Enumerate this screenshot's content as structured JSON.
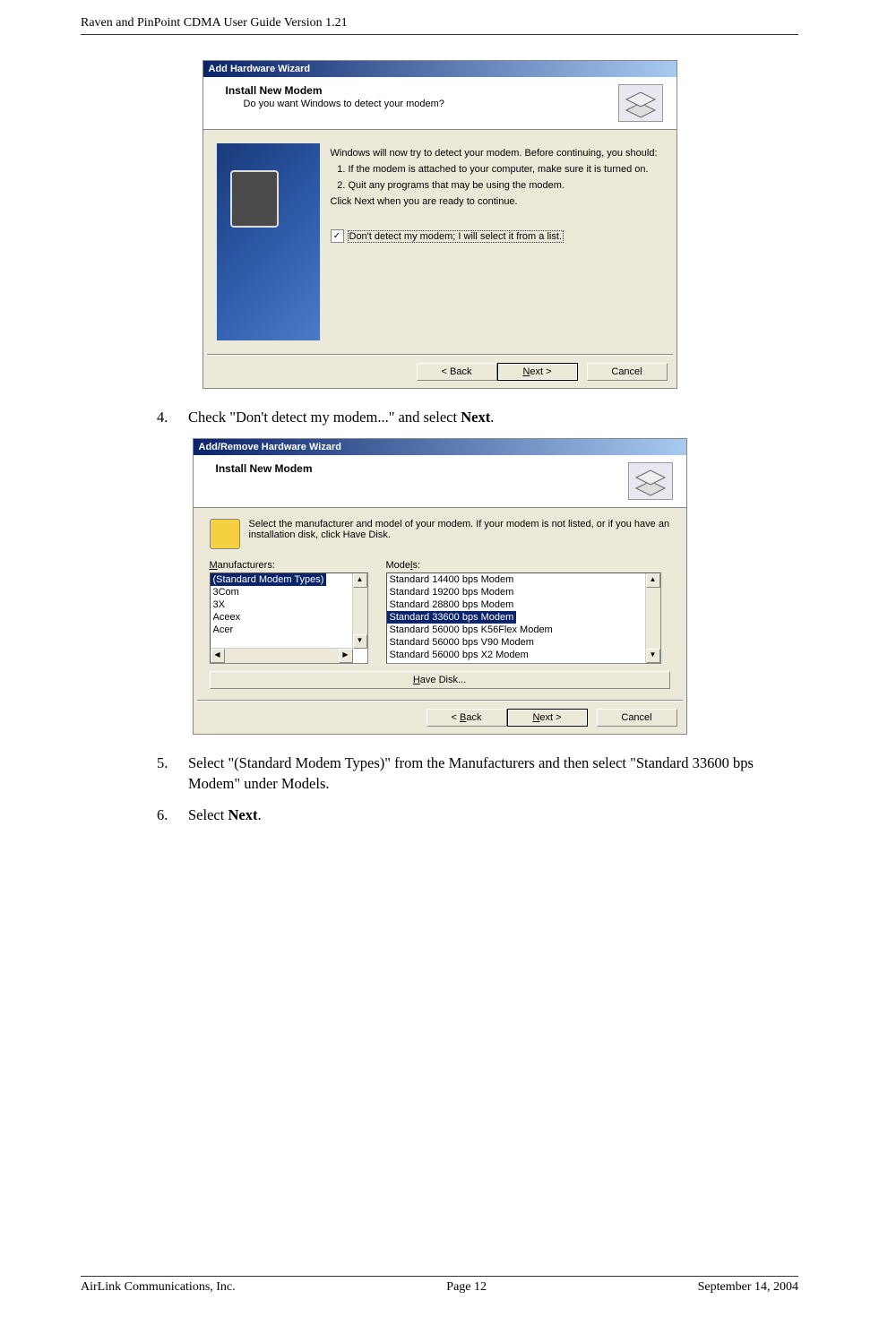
{
  "header": "Raven and PinPoint CDMA User Guide Version 1.21",
  "wizard1": {
    "title": "Add Hardware Wizard",
    "heading": "Install New Modem",
    "subheading": "Do you want Windows to detect your modem?",
    "bodyTop": "Windows will now try to detect your modem.  Before continuing, you should:",
    "list1": "If the modem is attached to your computer, make sure it is turned on.",
    "list2": "Quit any programs that may be using the modem.",
    "bodyBottom": "Click Next when you are ready to continue.",
    "checkboxLabel": "Don't detect my modem; I will select it from a list.",
    "buttons": {
      "back": "< Back",
      "next": "Next >",
      "cancel": "Cancel"
    }
  },
  "step4": {
    "num": "4.",
    "text_a": "Check \"Don't detect my modem...\" and select ",
    "text_b": "Next",
    "text_c": "."
  },
  "wizard2": {
    "title": "Add/Remove Hardware Wizard",
    "heading": "Install New Modem",
    "desc": "Select the manufacturer and model of your modem. If your modem is not listed, or if you have an installation disk, click Have Disk.",
    "mfrLabel": "Manufacturers:",
    "modelsLabel": "Models:",
    "manufacturers": [
      "(Standard Modem Types)",
      "3Com",
      "3X",
      "Aceex",
      "Acer"
    ],
    "models": [
      "Standard 14400 bps Modem",
      "Standard 19200 bps Modem",
      "Standard 28800 bps Modem",
      "Standard 33600 bps Modem",
      "Standard 56000 bps K56Flex Modem",
      "Standard 56000 bps V90 Modem",
      "Standard 56000 bps X2 Modem"
    ],
    "haveDisk": "Have Disk...",
    "buttons": {
      "back": "< Back",
      "next": "Next >",
      "cancel": "Cancel"
    }
  },
  "step5": {
    "num": "5.",
    "text": "Select \"(Standard Modem Types)\" from the Manufacturers and then select \"Standard 33600 bps Modem\" under Models."
  },
  "step6": {
    "num": "6.",
    "text_a": "Select ",
    "text_b": "Next",
    "text_c": "."
  },
  "footer": {
    "left": "AirLink Communications, Inc.",
    "center": "Page 12",
    "right": "September 14, 2004"
  }
}
